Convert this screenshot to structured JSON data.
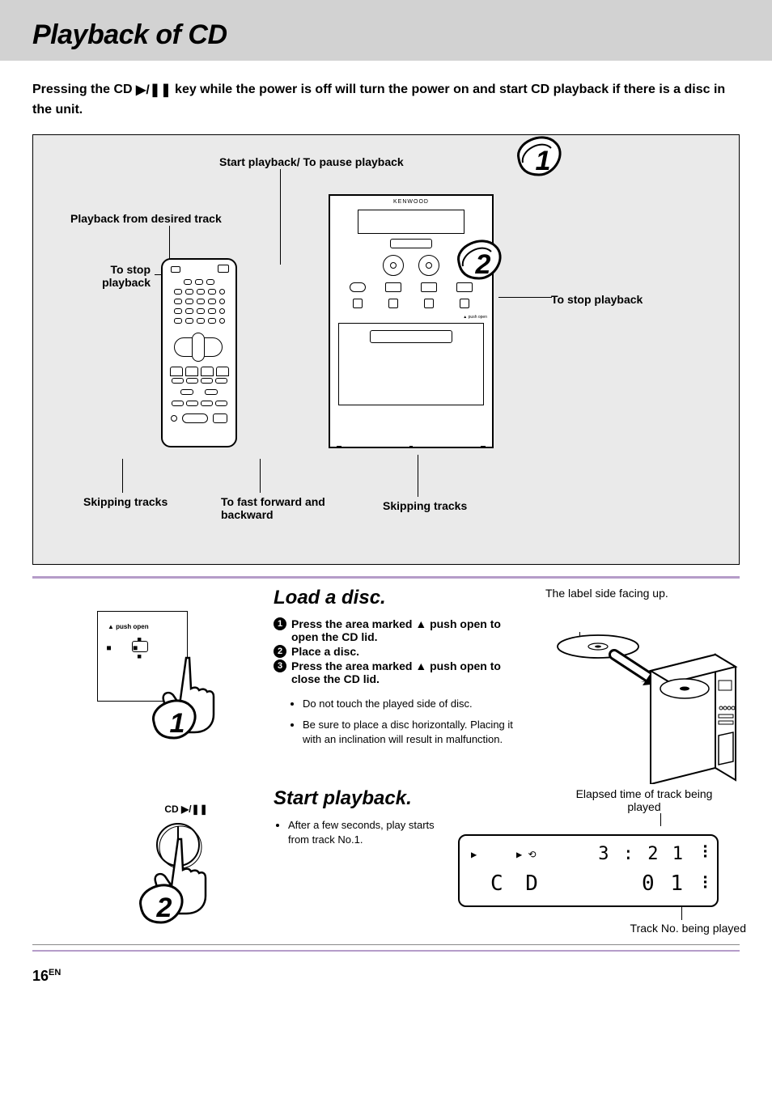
{
  "page": {
    "title": "Playback of CD",
    "intro_pre": "Pressing the CD ",
    "intro_post": " key while the power is off will turn the power on and start CD playback if there is a disc in the unit.",
    "page_number": "16",
    "page_lang": "EN"
  },
  "diagram": {
    "brand": "KENWOOD",
    "labels": {
      "start_pause": "Start playback/ To pause playback",
      "from_track": "Playback from desired track",
      "stop_left": "To stop playback",
      "stop_right": "To stop playback",
      "skip_left": "Skipping tracks",
      "ff_rw": "To fast forward and backward",
      "skip_right": "Skipping tracks",
      "push_open": "push open"
    },
    "callouts": {
      "one": "1",
      "two": "2"
    }
  },
  "step1": {
    "heading": "Load a disc.",
    "push_open": "push open",
    "substeps": [
      "Press the area marked ▲ push open  to open the CD lid.",
      "Place a disc.",
      "Press the area marked ▲ push open  to close the CD lid."
    ],
    "bullets": [
      "Do not touch the played side of disc.",
      "Be sure to place a disc horizontally. Placing it with an inclination will result in malfunction."
    ],
    "label_side": "The label side facing up.",
    "callout": "1"
  },
  "step2": {
    "heading": "Start playback.",
    "cd_btn": "CD ▶/❚❚",
    "bullets": [
      "After a few seconds, play starts from track No.1."
    ],
    "elapsed_label": "Elapsed time of track being played",
    "track_label": "Track No. being played",
    "display": {
      "mode_text": "C D",
      "time": "3 : 2 1",
      "track_no": "0 1"
    },
    "callout": "2"
  }
}
